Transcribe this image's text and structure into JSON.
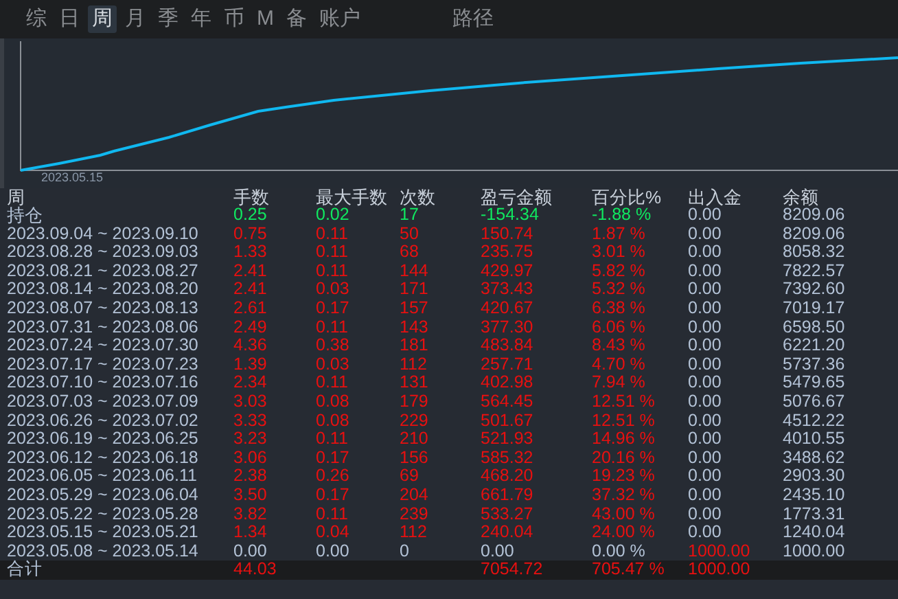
{
  "tabs": [
    {
      "label": "综",
      "selected": false
    },
    {
      "label": "日",
      "selected": false
    },
    {
      "label": "周",
      "selected": true
    },
    {
      "label": "月",
      "selected": false
    },
    {
      "label": "季",
      "selected": false
    },
    {
      "label": "年",
      "selected": false
    },
    {
      "label": "币",
      "selected": false
    },
    {
      "label": "M",
      "selected": false
    },
    {
      "label": "备",
      "selected": false
    },
    {
      "label": "账户",
      "selected": false
    }
  ],
  "path_tab": {
    "label": "路径",
    "selected": false
  },
  "chart": {
    "start_label": "2023.05.15"
  },
  "table": {
    "columns": [
      "周",
      "手数",
      "最大手数",
      "次数",
      "盈亏金额",
      "百分比%",
      "出入金",
      "余额"
    ],
    "rows": [
      {
        "color": "#10e860",
        "deposit_highlight": false,
        "cells": [
          "持仓",
          "0.25",
          "0.02",
          "17",
          "-154.34",
          "-1.88 %",
          "0.00",
          "8209.06"
        ]
      },
      {
        "color": "#e81010",
        "deposit_highlight": false,
        "cells": [
          "2023.09.04 ~ 2023.09.10",
          "0.75",
          "0.11",
          "50",
          "150.74",
          "1.87 %",
          "0.00",
          "8209.06"
        ]
      },
      {
        "color": "#e81010",
        "deposit_highlight": false,
        "cells": [
          "2023.08.28 ~ 2023.09.03",
          "1.33",
          "0.11",
          "68",
          "235.75",
          "3.01 %",
          "0.00",
          "8058.32"
        ]
      },
      {
        "color": "#e81010",
        "deposit_highlight": false,
        "cells": [
          "2023.08.21 ~ 2023.08.27",
          "2.41",
          "0.11",
          "144",
          "429.97",
          "5.82 %",
          "0.00",
          "7822.57"
        ]
      },
      {
        "color": "#e81010",
        "deposit_highlight": false,
        "cells": [
          "2023.08.14 ~ 2023.08.20",
          "2.41",
          "0.03",
          "171",
          "373.43",
          "5.32 %",
          "0.00",
          "7392.60"
        ]
      },
      {
        "color": "#e81010",
        "deposit_highlight": false,
        "cells": [
          "2023.08.07 ~ 2023.08.13",
          "2.61",
          "0.17",
          "157",
          "420.67",
          "6.38 %",
          "0.00",
          "7019.17"
        ]
      },
      {
        "color": "#e81010",
        "deposit_highlight": false,
        "cells": [
          "2023.07.31 ~ 2023.08.06",
          "2.49",
          "0.11",
          "143",
          "377.30",
          "6.06 %",
          "0.00",
          "6598.50"
        ]
      },
      {
        "color": "#e81010",
        "deposit_highlight": false,
        "cells": [
          "2023.07.24 ~ 2023.07.30",
          "4.36",
          "0.38",
          "181",
          "483.84",
          "8.43 %",
          "0.00",
          "6221.20"
        ]
      },
      {
        "color": "#e81010",
        "deposit_highlight": false,
        "cells": [
          "2023.07.17 ~ 2023.07.23",
          "1.39",
          "0.03",
          "112",
          "257.71",
          "4.70 %",
          "0.00",
          "5737.36"
        ]
      },
      {
        "color": "#e81010",
        "deposit_highlight": false,
        "cells": [
          "2023.07.10 ~ 2023.07.16",
          "2.34",
          "0.11",
          "131",
          "402.98",
          "7.94 %",
          "0.00",
          "5479.65"
        ]
      },
      {
        "color": "#e81010",
        "deposit_highlight": false,
        "cells": [
          "2023.07.03 ~ 2023.07.09",
          "3.03",
          "0.08",
          "179",
          "564.45",
          "12.51 %",
          "0.00",
          "5076.67"
        ]
      },
      {
        "color": "#e81010",
        "deposit_highlight": false,
        "cells": [
          "2023.06.26 ~ 2023.07.02",
          "3.33",
          "0.08",
          "229",
          "501.67",
          "12.51 %",
          "0.00",
          "4512.22"
        ]
      },
      {
        "color": "#e81010",
        "deposit_highlight": false,
        "cells": [
          "2023.06.19 ~ 2023.06.25",
          "3.23",
          "0.11",
          "210",
          "521.93",
          "14.96 %",
          "0.00",
          "4010.55"
        ]
      },
      {
        "color": "#e81010",
        "deposit_highlight": false,
        "cells": [
          "2023.06.12 ~ 2023.06.18",
          "3.06",
          "0.17",
          "156",
          "585.32",
          "20.16 %",
          "0.00",
          "3488.62"
        ]
      },
      {
        "color": "#e81010",
        "deposit_highlight": false,
        "cells": [
          "2023.06.05 ~ 2023.06.11",
          "2.38",
          "0.26",
          "69",
          "468.20",
          "19.23 %",
          "0.00",
          "2903.30"
        ]
      },
      {
        "color": "#e81010",
        "deposit_highlight": false,
        "cells": [
          "2023.05.29 ~ 2023.06.04",
          "3.50",
          "0.17",
          "204",
          "661.79",
          "37.32 %",
          "0.00",
          "2435.10"
        ]
      },
      {
        "color": "#e81010",
        "deposit_highlight": false,
        "cells": [
          "2023.05.22 ~ 2023.05.28",
          "3.82",
          "0.11",
          "239",
          "533.27",
          "43.00 %",
          "0.00",
          "1773.31"
        ]
      },
      {
        "color": "#e81010",
        "deposit_highlight": false,
        "cells": [
          "2023.05.15 ~ 2023.05.21",
          "1.34",
          "0.04",
          "112",
          "240.04",
          "24.00 %",
          "0.00",
          "1240.04"
        ]
      },
      {
        "color": "#b3c2d6",
        "deposit_highlight": true,
        "cells": [
          "2023.05.08 ~ 2023.05.14",
          "0.00",
          "0.00",
          "0",
          "0.00",
          "0.00 %",
          "1000.00",
          "1000.00"
        ]
      }
    ],
    "total": {
      "color": "#e81010",
      "deposit_highlight": true,
      "cells": [
        "合计",
        "44.03",
        "",
        "",
        "7054.72",
        "705.47 %",
        "1000.00",
        ""
      ]
    }
  }
}
